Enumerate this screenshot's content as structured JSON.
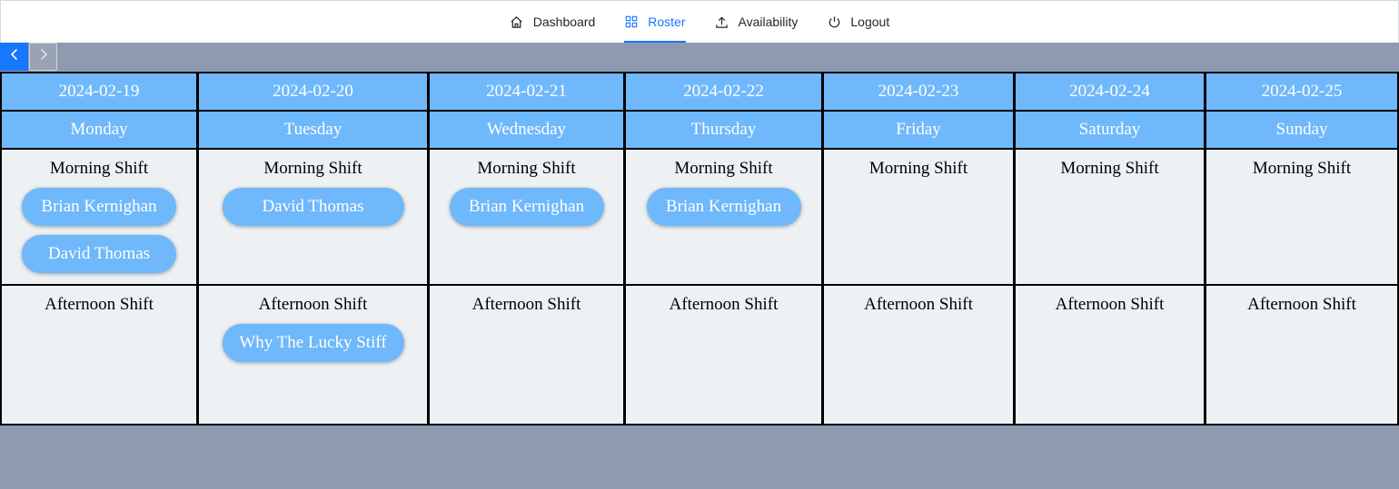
{
  "nav": {
    "items": [
      {
        "label": "Dashboard",
        "icon": "home-icon",
        "active": false
      },
      {
        "label": "Roster",
        "icon": "grid-icon",
        "active": true
      },
      {
        "label": "Availability",
        "icon": "upload-icon",
        "active": false
      },
      {
        "label": "Logout",
        "icon": "power-icon",
        "active": false
      }
    ],
    "accent_color": "#1677ff"
  },
  "pager": {
    "prev_icon": "chevron-left-icon",
    "next_icon": "chevron-right-icon"
  },
  "colors": {
    "header_bg": "#6fb8fb",
    "cell_bg": "#edf1f4",
    "page_bg": "#8e9ab0"
  },
  "roster": {
    "days": [
      {
        "date": "2024-02-19",
        "day": "Monday",
        "morning": {
          "label": "Morning Shift",
          "people": [
            "Brian Kernighan",
            "David Thomas"
          ]
        },
        "afternoon": {
          "label": "Afternoon Shift",
          "people": []
        }
      },
      {
        "date": "2024-02-20",
        "day": "Tuesday",
        "morning": {
          "label": "Morning Shift",
          "people": [
            "David Thomas"
          ]
        },
        "afternoon": {
          "label": "Afternoon Shift",
          "people": [
            "Why The Lucky Stiff"
          ]
        }
      },
      {
        "date": "2024-02-21",
        "day": "Wednesday",
        "morning": {
          "label": "Morning Shift",
          "people": [
            "Brian Kernighan"
          ]
        },
        "afternoon": {
          "label": "Afternoon Shift",
          "people": []
        }
      },
      {
        "date": "2024-02-22",
        "day": "Thursday",
        "morning": {
          "label": "Morning Shift",
          "people": [
            "Brian Kernighan"
          ]
        },
        "afternoon": {
          "label": "Afternoon Shift",
          "people": []
        }
      },
      {
        "date": "2024-02-23",
        "day": "Friday",
        "morning": {
          "label": "Morning Shift",
          "people": []
        },
        "afternoon": {
          "label": "Afternoon Shift",
          "people": []
        }
      },
      {
        "date": "2024-02-24",
        "day": "Saturday",
        "morning": {
          "label": "Morning Shift",
          "people": []
        },
        "afternoon": {
          "label": "Afternoon Shift",
          "people": []
        }
      },
      {
        "date": "2024-02-25",
        "day": "Sunday",
        "morning": {
          "label": "Morning Shift",
          "people": []
        },
        "afternoon": {
          "label": "Afternoon Shift",
          "people": []
        }
      }
    ]
  }
}
